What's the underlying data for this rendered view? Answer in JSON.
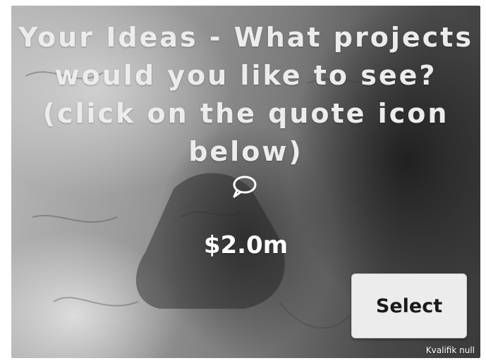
{
  "card": {
    "headline": "Your Ideas - What projects would you like to see? (click on the quote icon below)",
    "quote_icon": "speech-bubble-icon",
    "price": "$2.0m",
    "select_label": "Select",
    "footer_text": "Kvalifik null"
  },
  "colors": {
    "headline_text": "#ececec",
    "button_bg": "#ececec",
    "button_text": "#1a1a1a"
  }
}
